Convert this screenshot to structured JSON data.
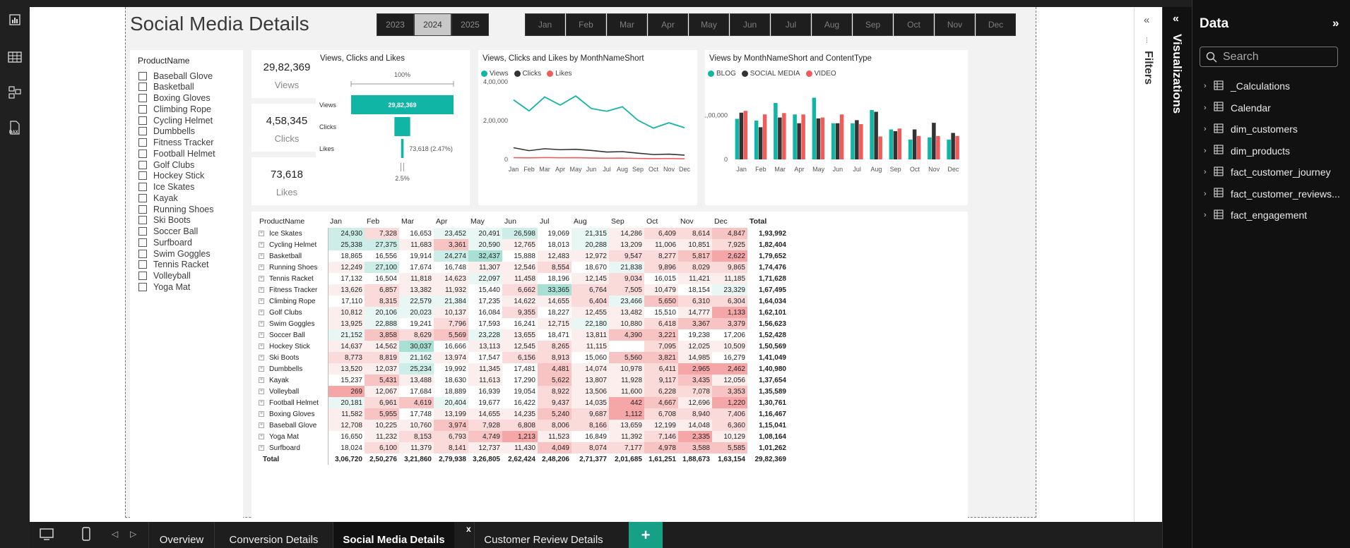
{
  "report": {
    "title": "Social Media Details",
    "years": [
      "2023",
      "2024",
      "2025"
    ],
    "selected_year": "2024",
    "months": [
      "Jan",
      "Feb",
      "Mar",
      "Apr",
      "May",
      "Jun",
      "Jul",
      "Aug",
      "Sep",
      "Oct",
      "Nov",
      "Dec"
    ]
  },
  "slicer": {
    "title": "ProductName",
    "items": [
      "Baseball Glove",
      "Basketball",
      "Boxing Gloves",
      "Climbing Rope",
      "Cycling Helmet",
      "Dumbbells",
      "Fitness Tracker",
      "Football Helmet",
      "Golf Clubs",
      "Hockey Stick",
      "Ice Skates",
      "Kayak",
      "Running Shoes",
      "Ski Boots",
      "Soccer Ball",
      "Surfboard",
      "Swim Goggles",
      "Tennis Racket",
      "Volleyball",
      "Yoga Mat"
    ]
  },
  "cards": [
    {
      "value": "29,82,369",
      "label": "Views"
    },
    {
      "value": "4,58,345",
      "label": "Clicks"
    },
    {
      "value": "73,618",
      "label": "Likes"
    }
  ],
  "funnel": {
    "title": "Views, Clicks and Likes",
    "top_pct": "100%",
    "bottom_pct": "2.5%",
    "stages": [
      {
        "label": "Views",
        "value": 2982369,
        "display": "29,82,369"
      },
      {
        "label": "Clicks",
        "value": 458345,
        "display": ""
      },
      {
        "label": "Likes",
        "value": 73618,
        "display": "73,618 (2.47%)"
      }
    ],
    "color": "#10b5a5"
  },
  "line_chart": {
    "title": "Views, Clicks and Likes by MonthNameShort",
    "legend": [
      {
        "name": "Views",
        "color": "#10b5a5"
      },
      {
        "name": "Clicks",
        "color": "#333333"
      },
      {
        "name": "Likes",
        "color": "#f05c5c"
      }
    ],
    "y_ticks": [
      "4,00,000",
      "2,00,000",
      "0"
    ]
  },
  "bar_chart": {
    "title": "Views by MonthNameShort and ContentType",
    "legend": [
      {
        "name": "BLOG",
        "color": "#10b5a5"
      },
      {
        "name": "SOCIAL MEDIA",
        "color": "#333333"
      },
      {
        "name": "VIDEO",
        "color": "#f05c5c"
      }
    ],
    "y_ticks": [
      "1,00,000",
      "0"
    ]
  },
  "chart_data": [
    {
      "type": "line",
      "title": "Views, Clicks and Likes by MonthNameShort",
      "categories": [
        "Jan",
        "Feb",
        "Mar",
        "Apr",
        "May",
        "Jun",
        "Jul",
        "Aug",
        "Sep",
        "Oct",
        "Nov",
        "Dec"
      ],
      "ylim": [
        0,
        400000
      ],
      "series": [
        {
          "name": "Views",
          "values": [
            306720,
            250276,
            321860,
            279938,
            326805,
            262424,
            248206,
            271377,
            201685,
            161251,
            188673,
            163154
          ]
        },
        {
          "name": "Clicks",
          "values": [
            60000,
            45000,
            55000,
            50000,
            52000,
            46000,
            38000,
            40000,
            32000,
            25000,
            27000,
            22000
          ]
        },
        {
          "name": "Likes",
          "values": [
            9000,
            8000,
            9500,
            8500,
            9000,
            7000,
            6000,
            6500,
            5000,
            4000,
            4500,
            3500
          ]
        }
      ]
    },
    {
      "type": "bar",
      "title": "Views by MonthNameShort and ContentType",
      "categories": [
        "Jan",
        "Feb",
        "Mar",
        "Apr",
        "May",
        "Jun",
        "Jul",
        "Aug",
        "Sep",
        "Oct",
        "Nov",
        "Dec"
      ],
      "ylim": [
        0,
        160000
      ],
      "series": [
        {
          "name": "BLOG",
          "values": [
            92000,
            88000,
            128000,
            102000,
            140000,
            82000,
            82000,
            112000,
            68000,
            45000,
            50000,
            45000
          ]
        },
        {
          "name": "SOCIAL MEDIA",
          "values": [
            106000,
            73000,
            95000,
            82000,
            93000,
            82000,
            89000,
            108000,
            64000,
            68000,
            83000,
            60000
          ]
        },
        {
          "name": "VIDEO",
          "values": [
            110000,
            102000,
            105000,
            102000,
            95000,
            102000,
            80000,
            52000,
            70000,
            53000,
            53000,
            53000
          ]
        }
      ]
    },
    {
      "type": "table",
      "title": "",
      "columns": [
        "ProductName",
        "Jan",
        "Feb",
        "Mar",
        "Apr",
        "May",
        "Jun",
        "Jul",
        "Aug",
        "Sep",
        "Oct",
        "Nov",
        "Dec",
        "Total"
      ],
      "rows": [
        [
          "Ice Skates",
          "24,930",
          "7,328",
          "16,653",
          "23,452",
          "20,491",
          "26,598",
          "19,069",
          "21,315",
          "14,286",
          "6,409",
          "8,614",
          "4,847",
          "1,93,992"
        ],
        [
          "Cycling Helmet",
          "25,338",
          "27,375",
          "11,683",
          "3,361",
          "20,590",
          "12,765",
          "18,013",
          "20,288",
          "13,209",
          "11,006",
          "10,851",
          "7,925",
          "1,82,404"
        ],
        [
          "Basketball",
          "18,865",
          "16,556",
          "19,914",
          "24,274",
          "32,437",
          "15,888",
          "12,483",
          "12,972",
          "9,547",
          "8,277",
          "5,817",
          "2,622",
          "1,79,652"
        ],
        [
          "Running Shoes",
          "12,249",
          "27,100",
          "17,674",
          "16,748",
          "11,307",
          "12,546",
          "8,554",
          "18,670",
          "21,838",
          "9,896",
          "8,029",
          "9,865",
          "1,74,476"
        ],
        [
          "Tennis Racket",
          "17,132",
          "16,504",
          "11,818",
          "14,623",
          "22,097",
          "11,458",
          "18,196",
          "12,145",
          "9,034",
          "16,015",
          "11,421",
          "11,185",
          "1,71,628"
        ],
        [
          "Fitness Tracker",
          "13,626",
          "6,857",
          "13,382",
          "11,932",
          "15,440",
          "6,662",
          "33,365",
          "6,764",
          "7,505",
          "10,479",
          "18,154",
          "23,329",
          "1,67,495"
        ],
        [
          "Climbing Rope",
          "17,110",
          "8,315",
          "22,579",
          "21,384",
          "17,235",
          "14,622",
          "14,655",
          "6,404",
          "23,466",
          "5,650",
          "6,310",
          "6,304",
          "1,64,034"
        ],
        [
          "Golf Clubs",
          "10,812",
          "20,106",
          "20,023",
          "10,137",
          "16,084",
          "9,355",
          "18,227",
          "12,455",
          "13,482",
          "15,510",
          "14,777",
          "1,133",
          "1,62,101"
        ],
        [
          "Swim Goggles",
          "13,925",
          "22,888",
          "19,241",
          "7,796",
          "17,593",
          "16,241",
          "12,715",
          "22,180",
          "10,880",
          "6,418",
          "3,367",
          "3,379",
          "1,56,623"
        ],
        [
          "Soccer Ball",
          "21,152",
          "3,858",
          "8,629",
          "5,569",
          "23,228",
          "13,655",
          "18,471",
          "13,811",
          "4,390",
          "3,221",
          "19,238",
          "17,206",
          "1,52,428"
        ],
        [
          "Hockey Stick",
          "14,637",
          "14,562",
          "30,037",
          "16,666",
          "13,113",
          "12,545",
          "8,265",
          "11,115",
          "",
          "7,095",
          "12,025",
          "10,509",
          "1,50,569"
        ],
        [
          "Ski Boots",
          "8,773",
          "8,819",
          "21,162",
          "13,974",
          "17,547",
          "6,156",
          "8,913",
          "15,060",
          "5,560",
          "3,821",
          "14,985",
          "16,279",
          "1,41,049"
        ],
        [
          "Dumbbells",
          "13,520",
          "12,037",
          "25,234",
          "19,992",
          "11,345",
          "17,481",
          "4,481",
          "14,074",
          "10,978",
          "6,411",
          "2,965",
          "2,462",
          "1,40,980"
        ],
        [
          "Kayak",
          "15,237",
          "5,431",
          "13,488",
          "18,630",
          "11,613",
          "17,290",
          "5,622",
          "13,807",
          "11,928",
          "9,117",
          "3,435",
          "12,056",
          "1,37,654"
        ],
        [
          "Volleyball",
          "269",
          "12,067",
          "17,684",
          "18,889",
          "16,939",
          "19,054",
          "8,922",
          "13,506",
          "11,600",
          "6,228",
          "7,078",
          "3,353",
          "1,35,589"
        ],
        [
          "Football Helmet",
          "20,181",
          "6,961",
          "4,619",
          "20,404",
          "19,677",
          "16,422",
          "9,437",
          "14,035",
          "442",
          "4,667",
          "12,696",
          "1,220",
          "1,30,761"
        ],
        [
          "Boxing Gloves",
          "11,582",
          "5,955",
          "17,748",
          "13,199",
          "14,655",
          "14,235",
          "5,240",
          "9,687",
          "1,112",
          "6,708",
          "8,940",
          "7,406",
          "1,16,467"
        ],
        [
          "Baseball Glove",
          "12,708",
          "10,225",
          "10,760",
          "3,974",
          "7,928",
          "6,808",
          "8,006",
          "8,166",
          "13,659",
          "12,199",
          "14,048",
          "6,360",
          "1,15,041"
        ],
        [
          "Yoga Mat",
          "16,650",
          "11,232",
          "8,153",
          "6,793",
          "4,749",
          "1,213",
          "11,523",
          "16,849",
          "11,392",
          "7,146",
          "2,335",
          "10,129",
          "1,08,164"
        ],
        [
          "Surfboard",
          "18,024",
          "6,100",
          "11,379",
          "8,141",
          "12,737",
          "11,430",
          "4,049",
          "8,074",
          "7,177",
          "4,978",
          "3,588",
          "5,585",
          "1,01,262"
        ]
      ],
      "total_row": [
        "Total",
        "3,06,720",
        "2,50,276",
        "3,21,860",
        "2,79,938",
        "3,26,805",
        "2,62,424",
        "2,48,206",
        "2,71,377",
        "2,01,685",
        "1,61,251",
        "1,88,673",
        "1,63,154",
        "29,82,369"
      ]
    }
  ],
  "panes": {
    "filters_label": "Filters",
    "visualizations_label": "Visualizations",
    "data_title": "Data",
    "search_placeholder": "Search",
    "data_items": [
      {
        "name": "_Calculations",
        "icon": "calculator-icon"
      },
      {
        "name": "Calendar",
        "icon": "calendar-table-icon"
      },
      {
        "name": "dim_customers",
        "icon": "table-icon"
      },
      {
        "name": "dim_products",
        "icon": "table-icon"
      },
      {
        "name": "fact_customer_journey",
        "icon": "table-icon"
      },
      {
        "name": "fact_customer_reviews...",
        "icon": "table-icon"
      },
      {
        "name": "fact_engagement",
        "icon": "table-icon"
      }
    ]
  },
  "tabs": [
    "Overview",
    "Conversion Details",
    "Social Media Details",
    "Customer Review Details"
  ],
  "active_tab": "Social Media Details",
  "colors": {
    "accent": "#10b5a5",
    "dark": "#333333",
    "red": "#f05c5c"
  }
}
